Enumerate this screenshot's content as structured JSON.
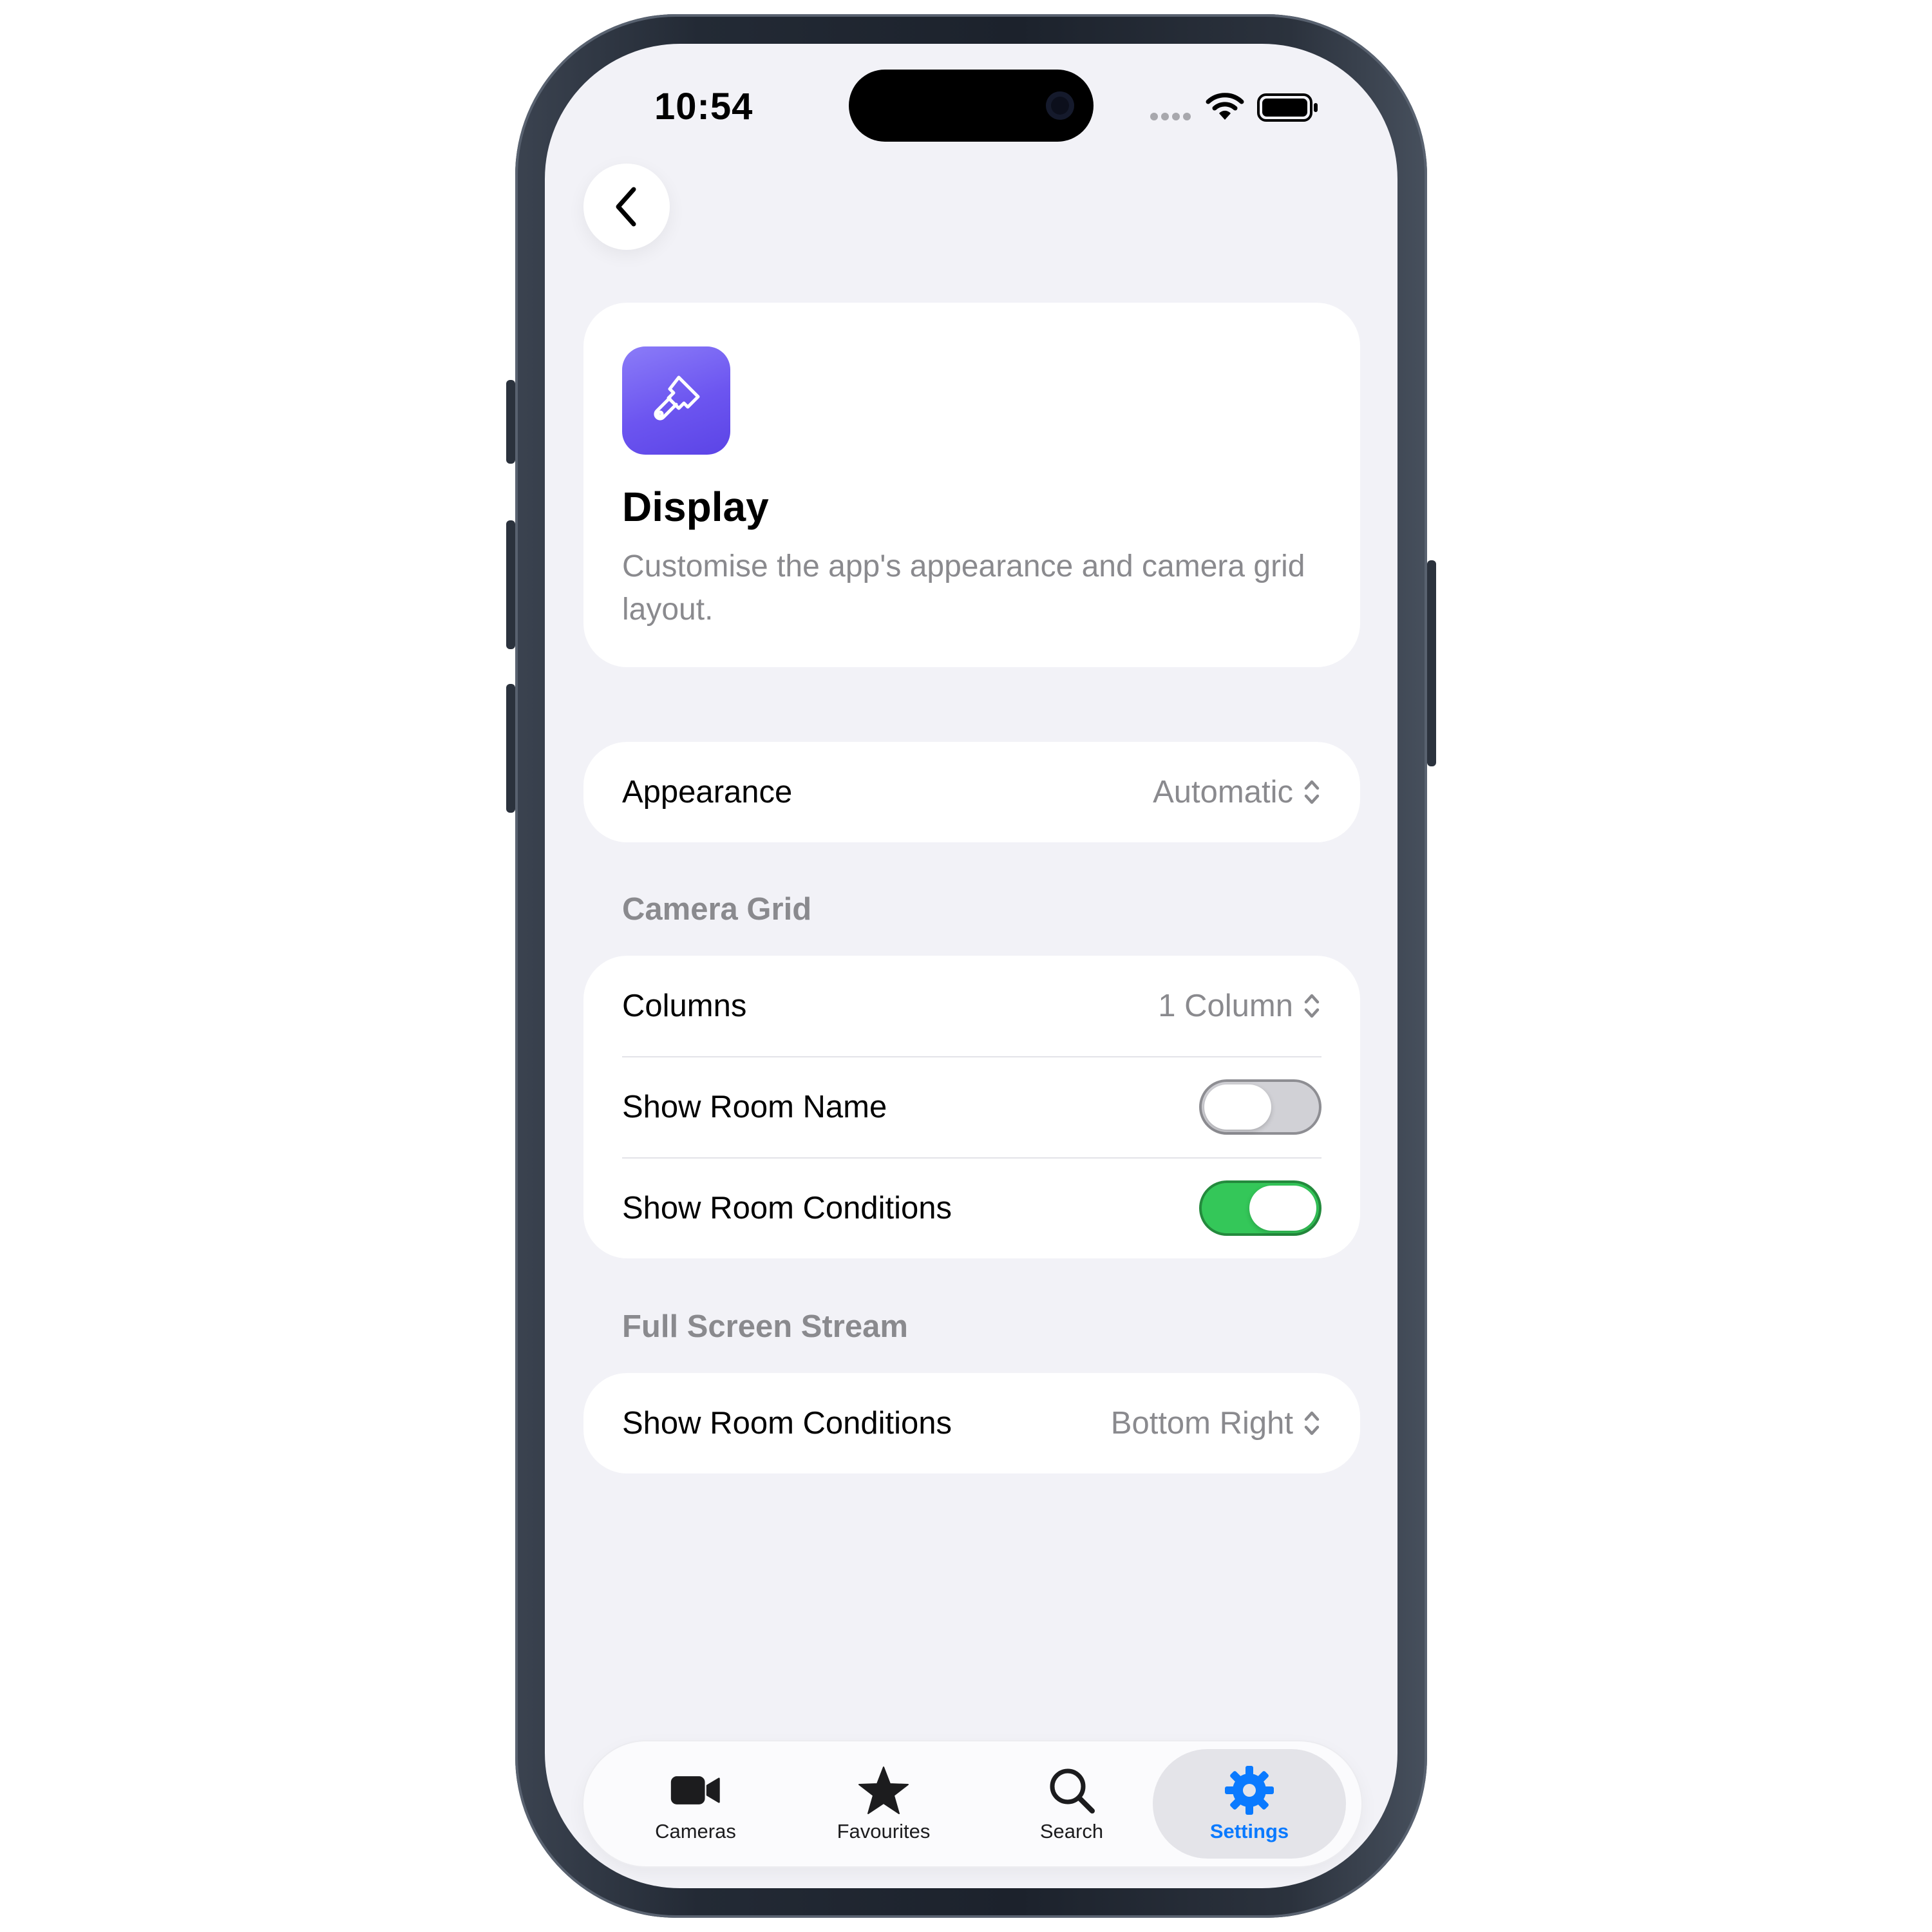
{
  "status_bar": {
    "time": "10:54"
  },
  "header": {
    "title": "Display",
    "description": "Customise the app's appearance and camera grid layout."
  },
  "appearance": {
    "label": "Appearance",
    "value": "Automatic"
  },
  "camera_grid": {
    "section_title": "Camera Grid",
    "columns_label": "Columns",
    "columns_value": "1 Column",
    "show_room_name_label": "Show Room Name",
    "show_room_name_on": false,
    "show_room_conditions_label": "Show Room Conditions",
    "show_room_conditions_on": true
  },
  "full_screen_stream": {
    "section_title": "Full Screen Stream",
    "show_room_conditions_label": "Show Room Conditions",
    "show_room_conditions_value": "Bottom Right"
  },
  "tabs": [
    {
      "label": "Cameras",
      "icon": "video-camera-icon",
      "active": false
    },
    {
      "label": "Favourites",
      "icon": "star-icon",
      "active": false
    },
    {
      "label": "Search",
      "icon": "search-icon",
      "active": false
    },
    {
      "label": "Settings",
      "icon": "gear-icon",
      "active": true
    }
  ],
  "colors": {
    "background": "#f2f2f7",
    "accent": "#0a7aff",
    "toggle_on": "#34c759",
    "app_icon": "#6c55f0"
  }
}
